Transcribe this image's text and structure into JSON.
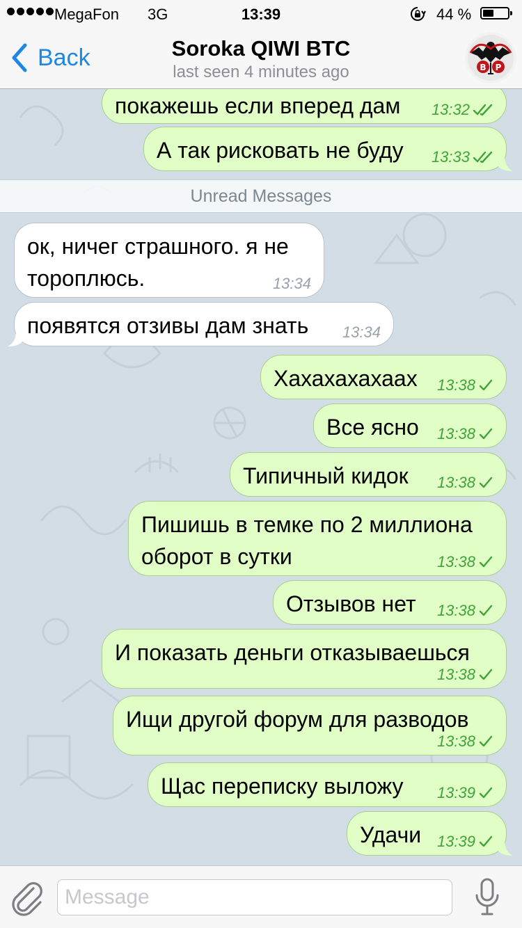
{
  "status_bar": {
    "carrier": "MegaFon",
    "network": "3G",
    "time": "13:39",
    "battery_percent": "44 %",
    "battery_level": 0.44
  },
  "nav": {
    "back_label": "Back",
    "title": "Soroka QIWI BTC",
    "subtitle": "last seen 4 minutes ago"
  },
  "chat": {
    "unread_label": "Unread Messages",
    "messages": [
      {
        "direction": "out",
        "text": "покажешь если вперед дам",
        "time": "13:32",
        "status": "read"
      },
      {
        "direction": "out",
        "text": "А так рисковать не буду",
        "time": "13:33",
        "status": "read"
      },
      {
        "direction": "in",
        "text": "ок, ничег страшного. я не\nтороплюсь.",
        "time": "13:34"
      },
      {
        "direction": "in",
        "text": "появятся отзивы дам знать",
        "time": "13:34"
      },
      {
        "direction": "out",
        "text": "Хахахахахаах",
        "time": "13:38",
        "status": "sent"
      },
      {
        "direction": "out",
        "text": "Все ясно",
        "time": "13:38",
        "status": "sent"
      },
      {
        "direction": "out",
        "text": "Типичный кидок",
        "time": "13:38",
        "status": "sent"
      },
      {
        "direction": "out",
        "text": "Пишишь в темке по 2 миллиона\nоборот в сутки",
        "time": "13:38",
        "status": "sent"
      },
      {
        "direction": "out",
        "text": "Отзывов нет",
        "time": "13:38",
        "status": "sent"
      },
      {
        "direction": "out",
        "text": "И показать деньги отказываешься",
        "time": "13:38",
        "status": "sent"
      },
      {
        "direction": "out",
        "text": "Ищи другой форум для разводов",
        "time": "13:38",
        "status": "sent"
      },
      {
        "direction": "out",
        "text": "Щас переписку выложу",
        "time": "13:39",
        "status": "sent"
      },
      {
        "direction": "out",
        "text": "Удачи",
        "time": "13:39",
        "status": "sent"
      }
    ]
  },
  "input": {
    "placeholder": "Message",
    "value": ""
  },
  "colors": {
    "accent": "#1d87e4",
    "outgoing_bubble": "#e1fec6",
    "incoming_bubble": "#ffffff",
    "check_green": "#3ea439",
    "chat_background": "#d3dde6"
  },
  "icons": {
    "back": "chevron-left-icon",
    "attach": "paperclip-icon",
    "mic": "microphone-icon",
    "read": "double-check-icon",
    "sent": "single-check-icon"
  }
}
